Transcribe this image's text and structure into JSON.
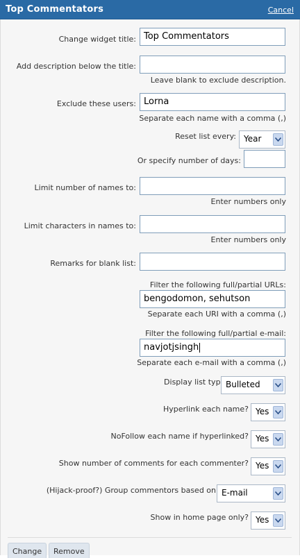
{
  "header": {
    "title": "Top Commentators",
    "cancel_label": "Cancel"
  },
  "fields": {
    "widget_title": {
      "label": "Change widget title:",
      "value": "Top Commentators"
    },
    "description": {
      "label": "Add description below the title:",
      "value": "",
      "hint": "Leave blank to exclude description."
    },
    "exclude_users": {
      "label": "Exclude these users:",
      "value": "Lorna",
      "hint": "Separate each name with a comma (,)"
    },
    "reset_list": {
      "label": "Reset list every:",
      "selected": "Year"
    },
    "num_days": {
      "label": "Or specify number of days:",
      "value": ""
    },
    "limit_names": {
      "label": "Limit number of names to:",
      "value": "",
      "hint": "Enter numbers only"
    },
    "limit_chars": {
      "label": "Limit characters in names to:",
      "value": "",
      "hint": "Enter numbers only"
    },
    "remarks": {
      "label": "Remarks for blank list:",
      "value": ""
    },
    "filter_urls": {
      "label": "Filter the following full/partial URLs:",
      "value": "bengodomon, sehutson",
      "hint": "Separate each URI with a comma (,)"
    },
    "filter_email": {
      "label": "Filter the following full/partial e-mail:",
      "value": "navjotjsingh",
      "hint": "Separate each e-mail with a comma (,)"
    },
    "list_type": {
      "label": "Display list type as:",
      "selected": "Bulleted"
    },
    "hyperlink": {
      "label": "Hyperlink each name?",
      "selected": "Yes"
    },
    "nofollow": {
      "label": "NoFollow each name if hyperlinked?",
      "selected": "Yes"
    },
    "show_count": {
      "label": "Show number of comments for each commenter?",
      "selected": "Yes"
    },
    "group_by": {
      "label": "(Hijack-proof?) Group commentors based on",
      "selected": "E-mail"
    },
    "home_only": {
      "label": "Show in home page only?",
      "selected": "Yes"
    }
  },
  "buttons": {
    "change": "Change",
    "remove": "Remove"
  },
  "colors": {
    "titlebar": "#2a6aa5",
    "panel": "#f6f6f6",
    "input_border": "#7f9db9"
  }
}
